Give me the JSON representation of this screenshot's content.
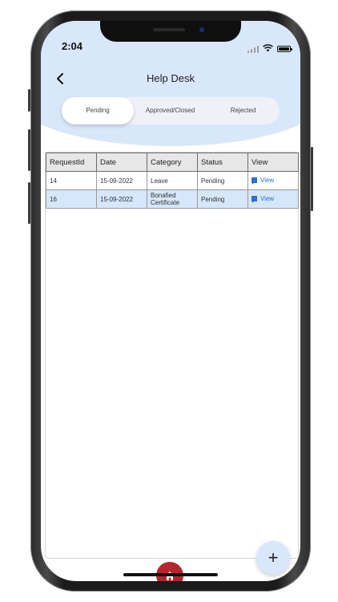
{
  "status_bar": {
    "time": "2:04"
  },
  "header": {
    "title": "Help Desk"
  },
  "tabs": [
    {
      "label": "Pending",
      "active": true
    },
    {
      "label": "Approved/Closed",
      "active": false
    },
    {
      "label": "Rejected",
      "active": false
    }
  ],
  "table": {
    "columns": [
      "RequestId",
      "Date",
      "Category",
      "Status",
      "View"
    ],
    "rows": [
      {
        "request_id": "14",
        "date": "15-09-2022",
        "category": "Leave",
        "status": "Pending",
        "view": "View",
        "selected": false
      },
      {
        "request_id": "16",
        "date": "15-09-2022",
        "category": "Bonafied Certificate",
        "status": "Pending",
        "view": "View",
        "selected": true
      }
    ]
  },
  "fab": {
    "label": "+"
  },
  "colors": {
    "header_bg": "#d9e7fb",
    "home_button": "#b3262f",
    "link": "#2d6fd2",
    "selected_row": "#d6e6fb"
  },
  "icons": [
    "back-arrow-icon",
    "wifi-icon",
    "signal-icon",
    "battery-icon",
    "flag-icon",
    "plus-icon",
    "home-icon"
  ]
}
